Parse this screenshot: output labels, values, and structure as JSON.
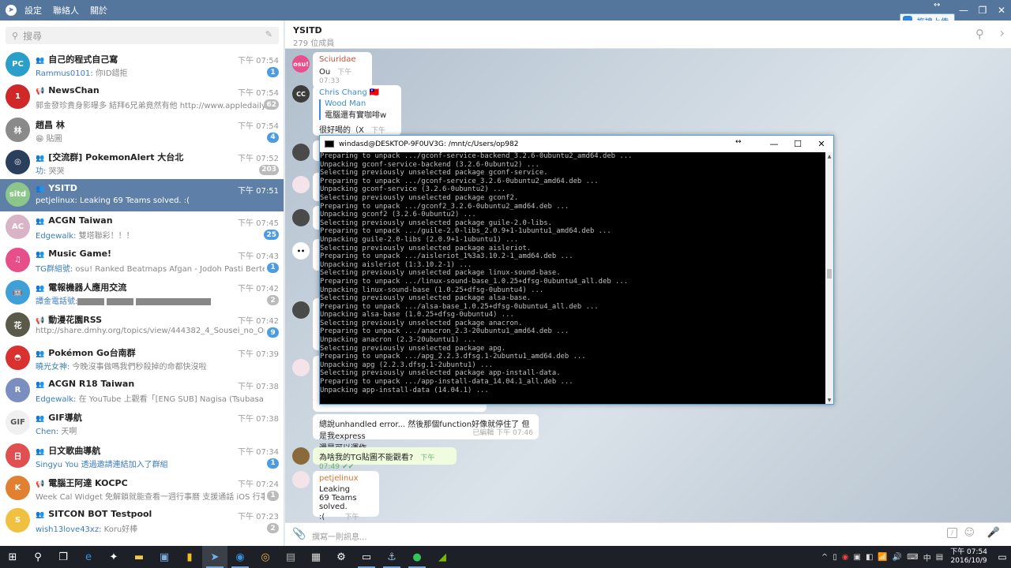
{
  "titlebar": {
    "menu": [
      "設定",
      "聯絡人",
      "關於"
    ]
  },
  "upload_badge": "拖拽上传",
  "search": {
    "placeholder": "搜尋"
  },
  "chats": [
    {
      "kind": "group",
      "name": "自己的程式自己寫",
      "time": "下午 07:54",
      "who": "Rammus0101:",
      "preview": " 你ID錯拒",
      "badge": "1",
      "muted": false,
      "avatar_color": "#2a9fc9",
      "avatar_text": "PC"
    },
    {
      "kind": "channel",
      "name": "NewsChan",
      "time": "下午 07:54",
      "who": "",
      "preview": "郭金發珍貴身影曝多 結拜6兄弟竟然有他 http://www.appledaily.com.tw/r...",
      "badge": "62",
      "muted": true,
      "avatar_color": "#d02828",
      "avatar_text": "1"
    },
    {
      "kind": "person",
      "name": "趙昌 林",
      "time": "下午 07:54",
      "who": "",
      "preview": "😁 貼圖",
      "badge": "4",
      "muted": false,
      "avatar_color": "#8a8a8a",
      "avatar_text": "林"
    },
    {
      "kind": "group",
      "name": "[交流群] PokemonAlert 大台北",
      "time": "下午 07:52",
      "who": "功:",
      "preview": " 哭哭",
      "badge": "203",
      "muted": true,
      "avatar_color": "#2a3f5c",
      "avatar_text": "◎"
    },
    {
      "kind": "group",
      "name": "YSITD",
      "time": "下午 07:51",
      "who": "petjelinux:",
      "preview": " Leaking 69 Teams solved. :(",
      "badge": "",
      "muted": false,
      "avatar_color": "#8cc68a",
      "avatar_text": "sitd",
      "active": true
    },
    {
      "kind": "group",
      "name": "ACGN Taiwan",
      "time": "下午 07:45",
      "who": "Edgewalk:",
      "preview": " 雙塔聯彩！！！",
      "badge": "25",
      "muted": false,
      "avatar_color": "#d9b4c6",
      "avatar_text": "AC"
    },
    {
      "kind": "group",
      "name": "Music Game!",
      "time": "下午 07:43",
      "who": "TG群組號:",
      "preview": " osu! Ranked Beatmaps Afgan - Jodoh Pasti Bertemu",
      "badge": "1",
      "muted": false,
      "avatar_color": "#e84f8a",
      "avatar_text": "♫"
    },
    {
      "kind": "group",
      "name": "電報機器人應用交流",
      "time": "下午 07:42",
      "who": "譚金電話號:",
      "preview": "",
      "badge": "2",
      "muted": true,
      "avatar_color": "#3fa0d8",
      "avatar_text": "🤖",
      "redacted": true
    },
    {
      "kind": "channel",
      "name": "動漫花園RSS",
      "time": "下午 07:42",
      "who": "",
      "preview": "http://share.dmhy.org/topics/view/444382_4_Sousei_no_Onmyouji_26_...",
      "badge": "9",
      "muted": false,
      "avatar_color": "#5a5a4a",
      "avatar_text": "花"
    },
    {
      "kind": "group",
      "name": "Pokémon Go台南群",
      "time": "下午 07:39",
      "who": "曉光女神:",
      "preview": " 今晚沒事做嗎我們秒殺掉的命都快沒啦",
      "badge": "",
      "muted": false,
      "avatar_color": "#d93030",
      "avatar_text": "◓"
    },
    {
      "kind": "group",
      "name": "ACGN R18 Taiwan",
      "time": "下午 07:38",
      "who": "Edgewalk:",
      "preview": " 在 YouTube 上觀看「[ENG SUB] Nagisa (Tsubasa Yonaga ) x Rei (D...",
      "badge": "",
      "muted": false,
      "avatar_color": "#7a8ec0",
      "avatar_text": "R"
    },
    {
      "kind": "group",
      "name": "GIF導航",
      "time": "下午 07:38",
      "who": "Chen:",
      "preview": " 天啊",
      "badge": "",
      "muted": false,
      "avatar_color": "#f0f0f0",
      "avatar_text": "GIF"
    },
    {
      "kind": "group",
      "name": "日文歌曲導航",
      "time": "下午 07:34",
      "who": "Singyu You 透過邀請連結加入了群組",
      "preview": "",
      "badge": "1",
      "muted": false,
      "avatar_color": "#e05050",
      "avatar_text": "日"
    },
    {
      "kind": "channel",
      "name": "電腦王阿達 KOCPC",
      "time": "下午 07:24",
      "who": "",
      "preview": "Week Cal Widget 免解鎖就能查看一週行事曆 支援通話 iOS 行事曆 #愛備...",
      "badge": "1",
      "muted": true,
      "avatar_color": "#e08030",
      "avatar_text": "K"
    },
    {
      "kind": "group",
      "name": "SITCON BOT Testpool",
      "time": "下午 07:23",
      "who": "wish13love43xz:",
      "preview": " Koru好棒",
      "badge": "2",
      "muted": true,
      "avatar_color": "#f0c040",
      "avatar_text": "S"
    }
  ],
  "chat": {
    "title": "YSITD",
    "members": "279 位成員"
  },
  "messages": {
    "m1": {
      "sender": "Sciuridae",
      "text": "Ou",
      "time": "下午 07:33"
    },
    "m2": {
      "sender": "Chris Chang 🇹🇼",
      "reply_name": "Wood Man",
      "reply_text": "電腦還有實咖啡w",
      "text": "很好喝的（X",
      "time": "下午 07:41"
    },
    "m3": {
      "text": "總說unhandled error... 然後那個function好像就停住了 但是我express",
      "text2": "還是可以運作",
      "edited": "已編輯",
      "time": "下午 07:46"
    },
    "m4": {
      "text": "為啥我的TG貼圖不能觀看?",
      "time": "下午 07:49",
      "check": "✔✔"
    },
    "m5": {
      "sender": "petjelinux",
      "lines": [
        "Leaking",
        "69 Teams solved.",
        ":("
      ],
      "time": "下午 07:51"
    }
  },
  "composer": {
    "placeholder": "撰寫一則訊息..."
  },
  "terminal": {
    "title": "windasd@DESKTOP-9F0UV3G: /mnt/c/Users/op982",
    "lines": [
      "Preparing to unpack .../gconf-service-backend_3.2.6-0ubuntu2_amd64.deb ...",
      "Unpacking gconf-service-backend (3.2.6-0ubuntu2) ...",
      "Selecting previously unselected package gconf-service.",
      "Preparing to unpack .../gconf-service_3.2.6-0ubuntu2_amd64.deb ...",
      "Unpacking gconf-service (3.2.6-0ubuntu2) ...",
      "Selecting previously unselected package gconf2.",
      "Preparing to unpack .../gconf2_3.2.6-0ubuntu2_amd64.deb ...",
      "Unpacking gconf2 (3.2.6-0ubuntu2) ...",
      "Selecting previously unselected package guile-2.0-libs.",
      "Preparing to unpack .../guile-2.0-libs_2.0.9+1-1ubuntu1_amd64.deb ...",
      "Unpacking guile-2.0-libs (2.0.9+1-1ubuntu1) ...",
      "Selecting previously unselected package aisleriot.",
      "Preparing to unpack .../aisleriot_1%3a3.10.2-1_amd64.deb ...",
      "Unpacking aisleriot (1:3.10.2-1) ...",
      "Selecting previously unselected package linux-sound-base.",
      "Preparing to unpack .../linux-sound-base_1.0.25+dfsg-0ubuntu4_all.deb ...",
      "Unpacking linux-sound-base (1.0.25+dfsg-0ubuntu4) ...",
      "Selecting previously unselected package alsa-base.",
      "Preparing to unpack .../alsa-base_1.0.25+dfsg-0ubuntu4_all.deb ...",
      "Unpacking alsa-base (1.0.25+dfsg-0ubuntu4) ...",
      "Selecting previously unselected package anacron.",
      "Preparing to unpack .../anacron_2.3-20ubuntu1_amd64.deb ...",
      "Unpacking anacron (2.3-20ubuntu1) ...",
      "Selecting previously unselected package apg.",
      "Preparing to unpack .../apg_2.2.3.dfsg.1-2ubuntu1_amd64.deb ...",
      "Unpacking apg (2.2.3.dfsg.1-2ubuntu1) ...",
      "Selecting previously unselected package app-install-data.",
      "Preparing to unpack .../app-install-data_14.04.1_all.deb ...",
      "Unpacking app-install-data (14.04.1) ..."
    ]
  },
  "taskbar": {
    "time": "下午 07:54",
    "date": "2016/10/9"
  }
}
